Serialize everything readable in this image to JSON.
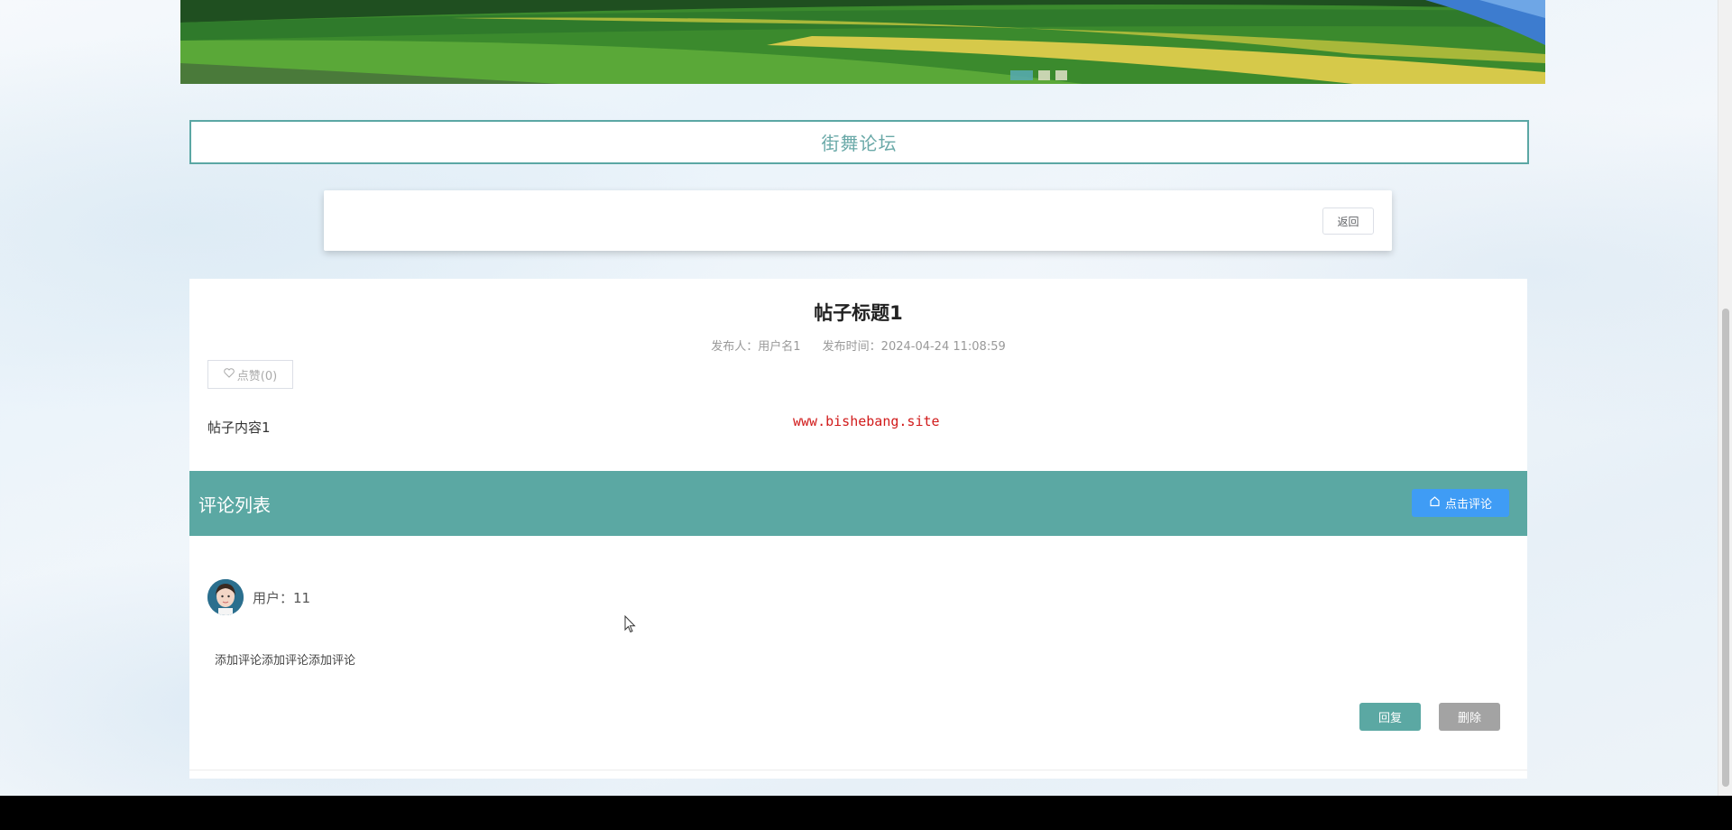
{
  "banner": {
    "active_slide": 1,
    "slide_count": 3
  },
  "section": {
    "title": "街舞论坛"
  },
  "toolbar": {
    "back_label": "返回"
  },
  "post": {
    "title": "帖子标题1",
    "author": "发布人：用户名1",
    "published": "发布时间：2024-04-24 11:08:59",
    "like_label": "点赞(0)",
    "content": "帖子内容1",
    "watermark": "www.bishebang.site"
  },
  "comments": {
    "header": "评论列表",
    "add_label": "点击评论",
    "items": [
      {
        "user": "用户：11",
        "text": "添加评论添加评论添加评论",
        "reply_label": "回复",
        "delete_label": "删除"
      }
    ]
  },
  "colors": {
    "accent": "#5ba8a3",
    "primary_button": "#3f9cf5",
    "delete_button": "#a3a3a3",
    "watermark": "#d11b1b"
  }
}
